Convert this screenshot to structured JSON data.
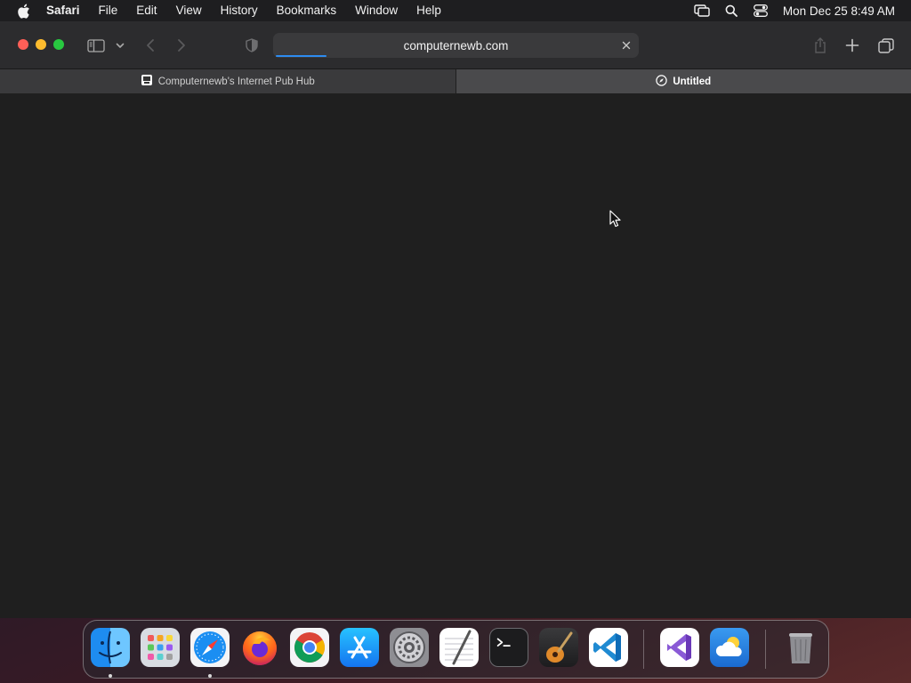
{
  "menubar": {
    "app_name": "Safari",
    "items": [
      "File",
      "Edit",
      "View",
      "History",
      "Bookmarks",
      "Window",
      "Help"
    ],
    "clock": "Mon Dec 25  8:49 AM"
  },
  "browser": {
    "address": "computernewb.com",
    "load_progress": 0.14,
    "tabs": [
      {
        "title": "Computernewb's Internet Pub Hub",
        "active": false
      },
      {
        "title": "Untitled",
        "active": true
      }
    ]
  },
  "dock": {
    "apps": [
      "Finder",
      "Launchpad",
      "Safari",
      "Firefox",
      "Chrome",
      "App Store",
      "System Preferences",
      "TextEdit",
      "Terminal",
      "GarageBand",
      "Visual Studio Code",
      "Visual Studio",
      "Weather"
    ],
    "running": [
      "Finder",
      "Safari"
    ]
  },
  "colors": {
    "accent": "#2d8cf0",
    "traffic_close": "#fe5f57",
    "traffic_min": "#febc2e",
    "traffic_max": "#28c840"
  }
}
